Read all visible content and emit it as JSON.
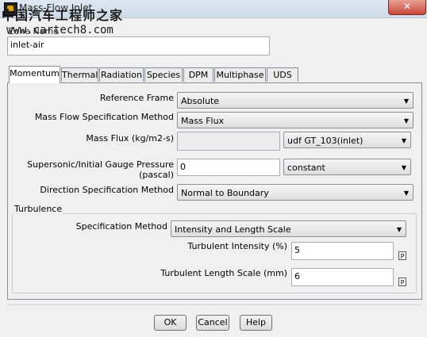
{
  "window": {
    "title": "Mass-Flow Inlet",
    "close_glyph": "✕"
  },
  "watermark": {
    "line1": "中国汽车工程师之家",
    "line2": "www.cartech8.com"
  },
  "zone": {
    "label": "Zone Name",
    "value": "inlet-air"
  },
  "tabs": [
    {
      "label": "Momentum",
      "active": true
    },
    {
      "label": "Thermal",
      "active": false
    },
    {
      "label": "Radiation",
      "active": false
    },
    {
      "label": "Species",
      "active": false
    },
    {
      "label": "DPM",
      "active": false
    },
    {
      "label": "Multiphase",
      "active": false
    },
    {
      "label": "UDS",
      "active": false
    }
  ],
  "momentum": {
    "reference_frame": {
      "label": "Reference Frame",
      "value": "Absolute"
    },
    "mass_flow_spec": {
      "label": "Mass Flow Specification Method",
      "value": "Mass Flux"
    },
    "mass_flux": {
      "label": "Mass Flux (kg/m2-s)",
      "value": "",
      "profile": "udf GT_103(inlet)"
    },
    "pressure": {
      "label": "Supersonic/Initial Gauge Pressure (pascal)",
      "value": "0",
      "profile": "constant"
    },
    "direction": {
      "label": "Direction Specification Method",
      "value": "Normal to Boundary"
    }
  },
  "turbulence": {
    "group_label": "Turbulence",
    "spec_method": {
      "label": "Specification Method",
      "value": "Intensity and Length Scale"
    },
    "intensity": {
      "label": "Turbulent Intensity (%)",
      "value": "5",
      "param": "P"
    },
    "length_scale": {
      "label": "Turbulent Length Scale (mm)",
      "value": "6",
      "param": "P"
    }
  },
  "buttons": {
    "ok": "OK",
    "cancel": "Cancel",
    "help": "Help"
  },
  "dropdown_arrow": "▼"
}
